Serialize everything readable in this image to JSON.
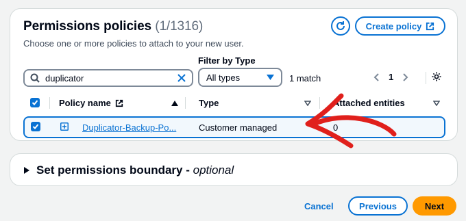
{
  "policies": {
    "title": "Permissions policies",
    "count": "(1/1316)",
    "description": "Choose one or more policies to attach to your new user.",
    "create_label": "Create policy",
    "filter_label": "Filter by Type",
    "search_value": "duplicator",
    "type_value": "All types",
    "match_text": "1 match",
    "page": "1",
    "columns": {
      "name": "Policy name",
      "type": "Type",
      "attached": "Attached entities"
    },
    "rows": [
      {
        "name": "Duplicator-Backup-Po...",
        "type": "Customer managed",
        "attached": "0"
      }
    ]
  },
  "boundary": {
    "title": "Set permissions boundary - ",
    "optional": "optional"
  },
  "footer": {
    "cancel": "Cancel",
    "previous": "Previous",
    "next": "Next"
  },
  "colors": {
    "accent": "#0972d3",
    "primary_button": "#ff9900",
    "annotation_arrow": "#e0201c"
  }
}
